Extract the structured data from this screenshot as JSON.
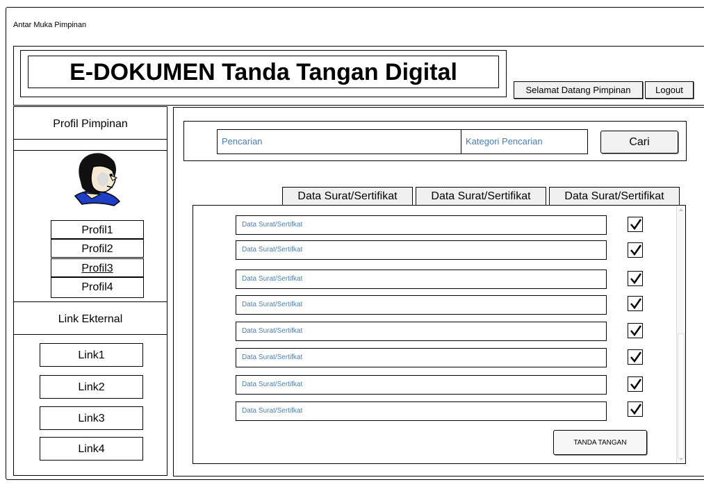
{
  "window": {
    "title": "Antar Muka Pimpinan"
  },
  "header": {
    "app_title": "E-DOKUMEN Tanda Tangan Digital",
    "welcome_label": "Selamat Datang Pimpinan",
    "logout_label": "Logout"
  },
  "sidebar": {
    "profile_heading": "Profil Pimpinan",
    "avatar_icon": "avatar-face-icon",
    "profiles": [
      "Profil1",
      "Profil2",
      "Profil3",
      "Profil4"
    ],
    "links_heading": "Link Ekternal",
    "links": [
      "Link1",
      "Link2",
      "Link3",
      "Link4"
    ]
  },
  "search": {
    "query_placeholder": "Pencarian",
    "category_placeholder": "Kategori Pencarian",
    "button_label": "Cari"
  },
  "tabs": [
    "Data Surat/Sertifikat",
    "Data Surat/Sertifikat",
    "Data Surat/Sertifikat"
  ],
  "documents": {
    "rows": [
      {
        "label": "Data Surat/Sertifkat",
        "checked": true
      },
      {
        "label": "Data Surat/Sertifkat",
        "checked": true
      },
      {
        "label": "Data Surat/Sertifkat",
        "checked": true
      },
      {
        "label": "Data Surat/Sertifkat",
        "checked": true
      },
      {
        "label": "Data Surat/Sertifkat",
        "checked": true
      },
      {
        "label": "Data Surat/Sertifkat",
        "checked": true
      },
      {
        "label": "Data Surat/Sertifkat",
        "checked": true
      },
      {
        "label": "Data Surat/Sertifkat",
        "checked": true
      }
    ],
    "sign_button_label": "TANDA TANGAN"
  }
}
